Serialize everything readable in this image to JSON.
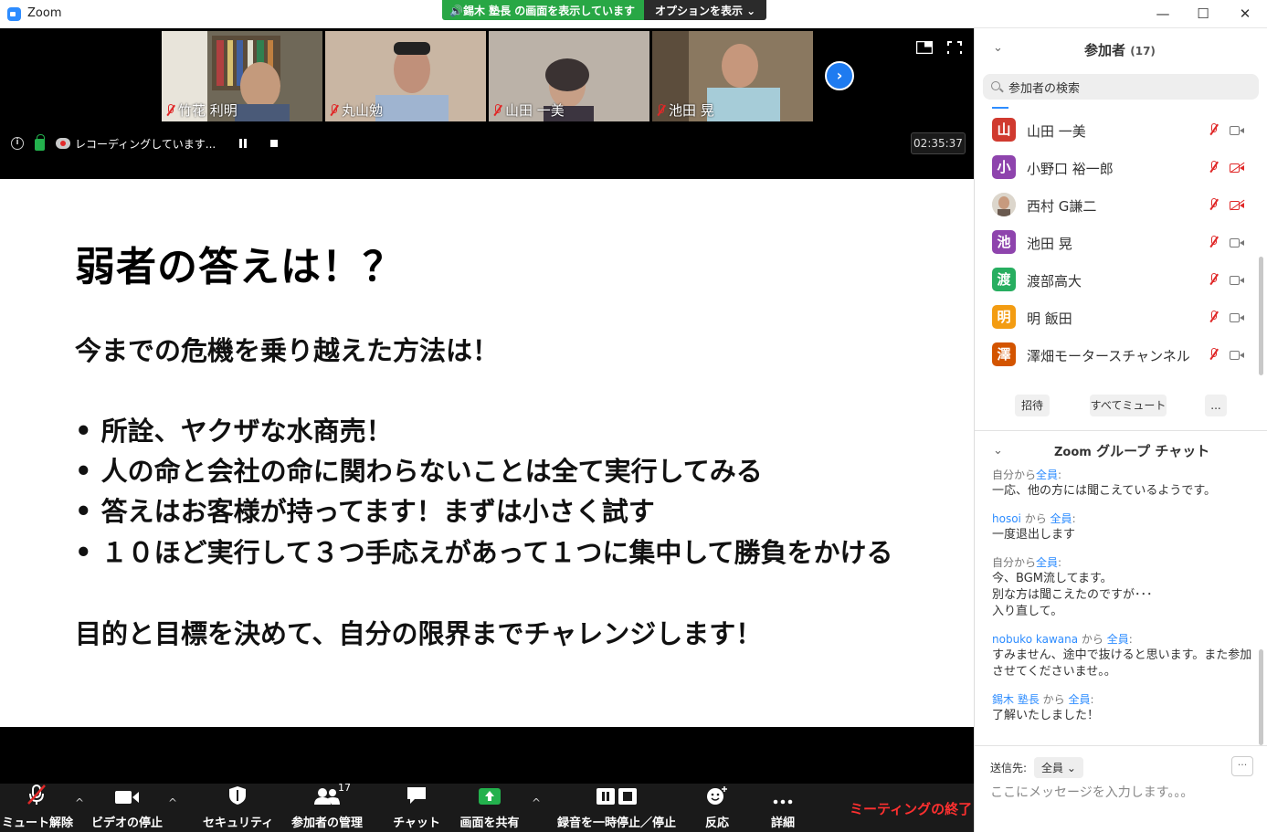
{
  "window": {
    "app_title": "Zoom",
    "share_banner": "🔊錫木 塾長 の画面を表示しています",
    "view_options": "オプションを表示 ⌄",
    "minimize": "—",
    "maximize": "☐",
    "close": "✕"
  },
  "video": {
    "tiles": [
      {
        "name": "竹花 利明",
        "bg": "#7a7466"
      },
      {
        "name": "丸山勉",
        "bg": "#c8b7a6"
      },
      {
        "name": "山田 一美",
        "bg": "#b9b0a6"
      },
      {
        "name": "池田 晃",
        "bg": "#8c7a60"
      }
    ],
    "next": "›",
    "recording_text": "レコーディングしています...",
    "timer": "02:35:37"
  },
  "slide": {
    "title": "弱者の答えは！？",
    "line1": "今までの危機を乗り越えた方法は！",
    "bullet1": "• 所詮、ヤクザな水商売！",
    "bullet2": "• 人の命と会社の命に関わらないことは全て実行してみる",
    "bullet3": "• 答えはお客様が持ってます！まずは小さく試す",
    "bullet4": "• １０ほど実行して３つ手応えがあって１つに集中して勝負をかける",
    "line_last": "目的と目標を決めて、自分の限界までチャレンジします！"
  },
  "toolbar": {
    "unmute": "ミュート解除",
    "stop_video": "ビデオの停止",
    "security": "セキュリティ",
    "participants": "参加者の管理",
    "participants_count": "17",
    "chat": "チャット",
    "share": "画面を共有",
    "recording": "録音を一時停止／停止",
    "reactions": "反応",
    "more": "詳細",
    "end": "ミーティングの終了",
    "caret": "^"
  },
  "panel": {
    "caret": "⌄",
    "title": "参加者",
    "count": "(17)",
    "search_placeholder": "参加者の検索",
    "participants": [
      {
        "initial": "山",
        "name": "山田 一美",
        "color": "#d03a2f",
        "video_off": false
      },
      {
        "initial": "小",
        "name": "小野口 裕一郎",
        "color": "#8e44ad",
        "video_off": true
      },
      {
        "initial": "",
        "name": "西村 G謙二",
        "color": "#dcd6cc",
        "video_off": true
      },
      {
        "initial": "池",
        "name": "池田 晃",
        "color": "#8e44ad",
        "video_off": false
      },
      {
        "initial": "渡",
        "name": "渡部高大",
        "color": "#27ae60",
        "video_off": false
      },
      {
        "initial": "明",
        "name": "明 飯田",
        "color": "#f39c12",
        "video_off": false
      },
      {
        "initial": "澤",
        "name": "澤畑モータースチャンネル",
        "color": "#d35400",
        "video_off": false
      }
    ],
    "invite": "招待",
    "mute_all": "すべてミュート",
    "more": "...",
    "chat_title_prefix": "Zoom",
    "chat_title": "グループ チャット",
    "messages": [
      {
        "from": "自分",
        "mid": "から",
        "to": "全員",
        "colon": ":",
        "text": "一応、他の方には聞こえているようです。"
      },
      {
        "from": "hosoi",
        "mid": "から",
        "to": "全員",
        "colon": ":",
        "text": "一度退出します"
      },
      {
        "from": "自分",
        "mid": "から",
        "to": "全員",
        "colon": ":",
        "text": "今、BGM流してます。\n別な方は聞こえたのですが･･･\n入り直して。"
      },
      {
        "from": "nobuko kawana",
        "mid": "から",
        "to": "全員",
        "colon": ":",
        "text": "すみません、途中で抜けると思います。また参加させてくださいませ。。"
      },
      {
        "from": "錫木 塾長",
        "mid": "から",
        "to": "全員",
        "colon": ":",
        "text": "了解いたしました！"
      }
    ],
    "send_to_label": "送信先:",
    "send_to_value": "全員 ⌄",
    "chat_more": "···",
    "input_placeholder": "ここにメッセージを入力します。。。"
  }
}
